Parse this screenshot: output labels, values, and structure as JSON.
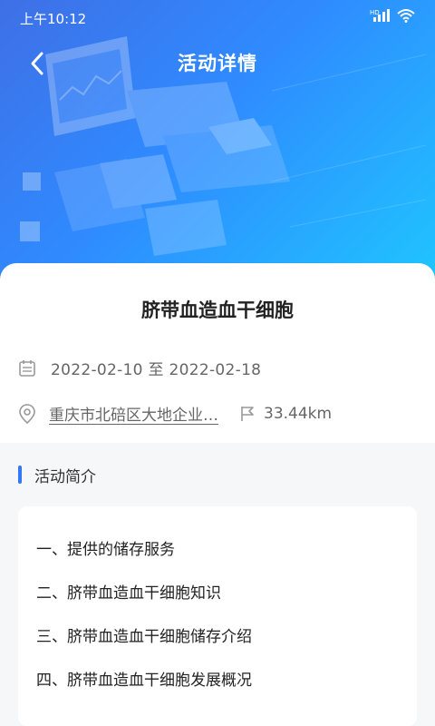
{
  "status_bar": {
    "time": "上午10:12"
  },
  "header": {
    "title": "活动详情"
  },
  "event": {
    "title": "脐带血造血干细胞",
    "date_range": "2022-02-10 至 2022-02-18",
    "address": "重庆市北碚区大地企业…",
    "distance": "33.44km"
  },
  "intro": {
    "section_title": "活动简介",
    "items": [
      "一、提供的储存服务",
      "二、脐带血造血干细胞知识",
      "三、脐带血造血干细胞储存介绍",
      "四、脐带血造血干细胞发展概况"
    ]
  },
  "colors": {
    "accent": "#3478f6",
    "hero_start": "#3f6fe6",
    "hero_end": "#1fc6ff"
  }
}
